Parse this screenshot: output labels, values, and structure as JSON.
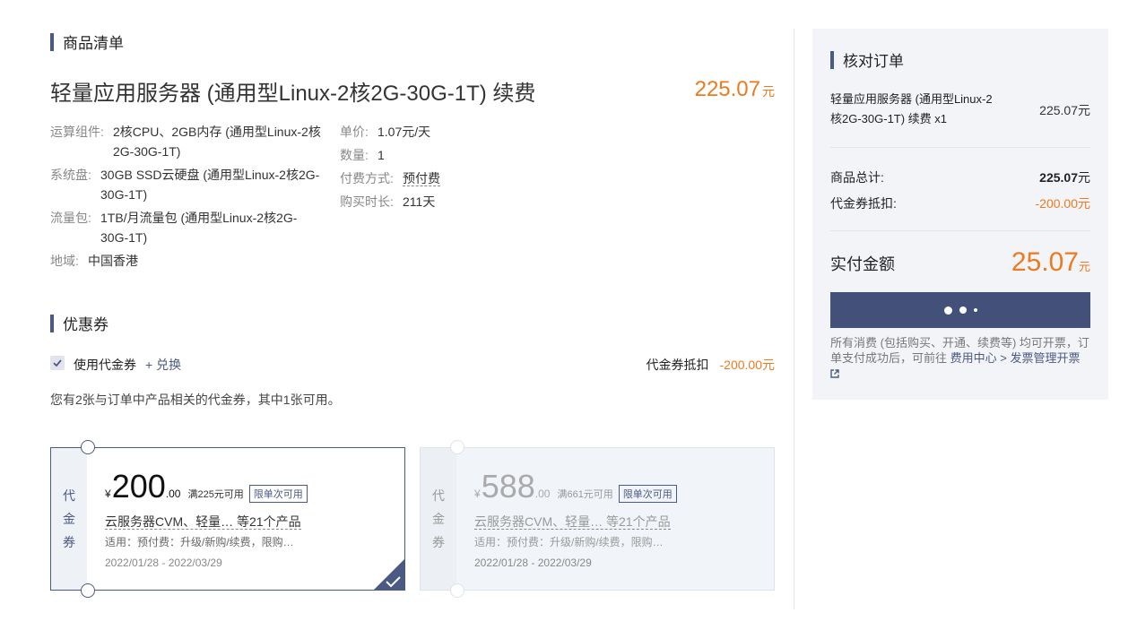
{
  "product_section": {
    "title": "商品清单",
    "product_name": "轻量应用服务器 (通用型Linux-2核2G-30G-1T) 续费",
    "price": "225.07",
    "price_unit": "元",
    "specs": [
      {
        "label": "运算组件:",
        "value": "2核CPU、2GB内存 (通用型Linux-2核2G-30G-1T)"
      },
      {
        "label": "系统盘:",
        "value": "30GB SSD云硬盘 (通用型Linux-2核2G-30G-1T)"
      },
      {
        "label": "流量包:",
        "value": "1TB/月流量包 (通用型Linux-2核2G-30G-1T)"
      },
      {
        "label": "地域:",
        "value": "中国香港"
      }
    ],
    "details": [
      {
        "label": "单价:",
        "value": "1.07元/天"
      },
      {
        "label": "数量:",
        "value": "1"
      },
      {
        "label": "付费方式:",
        "value": "预付费"
      },
      {
        "label": "购买时长:",
        "value": "211天"
      }
    ]
  },
  "coupon_section": {
    "title": "优惠券",
    "use_label": "使用代金券",
    "use_checked": true,
    "exchange_link": "+ 兑换",
    "deduction_label": "代金券抵扣",
    "deduction_value": "-200.00元",
    "hint": "您有2张与订单中产品相关的代金券，其中1张可用。",
    "coupons": [
      {
        "side_label": [
          "代",
          "金",
          "券"
        ],
        "currency": "¥",
        "amount_int": "200",
        "amount_dec": ".00",
        "condition": "满225元可用",
        "tag": "限单次可用",
        "products": "云服务器CVM、轻量… 等21个产品",
        "apply": "适用：预付费：升级/新购/续费，限购…",
        "dates": "2022/01/28 - 2022/03/29",
        "selected": true
      },
      {
        "side_label": [
          "代",
          "金",
          "券"
        ],
        "currency": "¥",
        "amount_int": "588",
        "amount_dec": ".00",
        "condition": "满661元可用",
        "tag": "限单次可用",
        "products": "云服务器CVM、轻量… 等21个产品",
        "apply": "适用：预付费：升级/新购/续费，限购…",
        "dates": "2022/01/28 - 2022/03/29",
        "selected": false
      }
    ]
  },
  "summary": {
    "title": "核对订单",
    "item_name_line1": "轻量应用服务器 (通用型Linux-2",
    "item_name_line2": "核2G-30G-1T) 续费 x1",
    "item_price": "225.07",
    "item_price_unit": "元",
    "total_label": "商品总计:",
    "total_value": "225.07",
    "total_unit": "元",
    "coupon_label": "代金券抵扣:",
    "coupon_value": "-200.00元",
    "pay_label": "实付金额",
    "pay_value": "25.07",
    "pay_unit": "元",
    "note_prefix": "所有消费 (包括购买、开通、续费等) 均可开票，订单支付成功后，可前往",
    "note_link": "费用中心 > 发票管理开票",
    "colors": {
      "accent": "#4b5a82",
      "price": "#ed7a1e",
      "button": "#43507a"
    }
  }
}
